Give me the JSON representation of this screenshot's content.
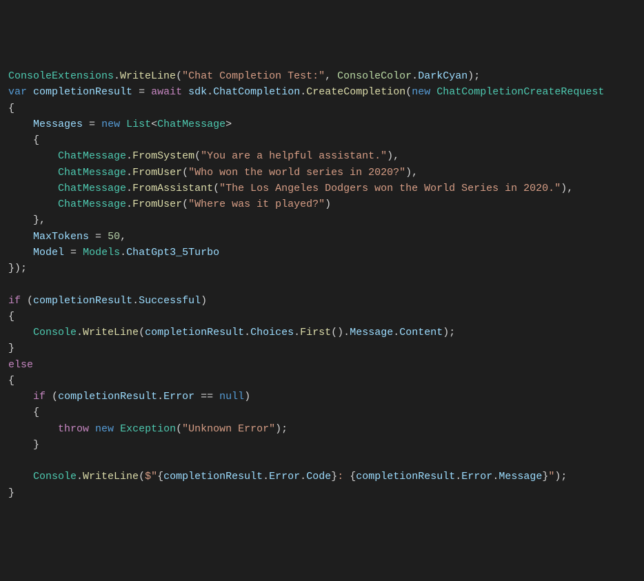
{
  "code": {
    "line1": {
      "cls": "ConsoleExtensions",
      "method": "WriteLine",
      "str": "\"Chat Completion Test:\"",
      "enumCls": "ConsoleColor",
      "enumVal": "DarkCyan"
    },
    "line2": {
      "kwVar": "var",
      "varName": "completionResult",
      "kwAwait": "await",
      "sdk": "sdk",
      "prop": "ChatCompletion",
      "method": "CreateCompletion",
      "kwNew": "new",
      "type": "ChatCompletionCreateRequest"
    },
    "line4": {
      "prop": "Messages",
      "kwNew": "new",
      "type": "List",
      "generic": "ChatMessage"
    },
    "msgs": {
      "cls": "ChatMessage",
      "m1": {
        "method": "FromSystem",
        "str": "\"You are a helpful assistant.\""
      },
      "m2": {
        "method": "FromUser",
        "str": "\"Who won the world series in 2020?\""
      },
      "m3": {
        "method": "FromAssistant",
        "str": "\"The Los Angeles Dodgers won the World Series in 2020.\""
      },
      "m4": {
        "method": "FromUser",
        "str": "\"Where was it played?\""
      }
    },
    "line11": {
      "prop": "MaxTokens",
      "val": "50"
    },
    "line12": {
      "prop": "Model",
      "cls": "Models",
      "val": "ChatGpt3_5Turbo"
    },
    "line15": {
      "kw": "if",
      "var": "completionResult",
      "prop": "Successful"
    },
    "line17": {
      "cls": "Console",
      "method": "WriteLine",
      "var": "completionResult",
      "p1": "Choices",
      "m1": "First",
      "p2": "Message",
      "p3": "Content"
    },
    "line19": {
      "kw": "else"
    },
    "line21": {
      "kw": "if",
      "var": "completionResult",
      "prop": "Error",
      "kwNull": "null"
    },
    "line23": {
      "kwThrow": "throw",
      "kwNew": "new",
      "type": "Exception",
      "str": "\"Unknown Error\""
    },
    "line26": {
      "cls": "Console",
      "method": "WriteLine",
      "var1": "completionResult",
      "p1a": "Error",
      "p1b": "Code",
      "var2": "completionResult",
      "p2a": "Error",
      "p2b": "Message"
    }
  }
}
